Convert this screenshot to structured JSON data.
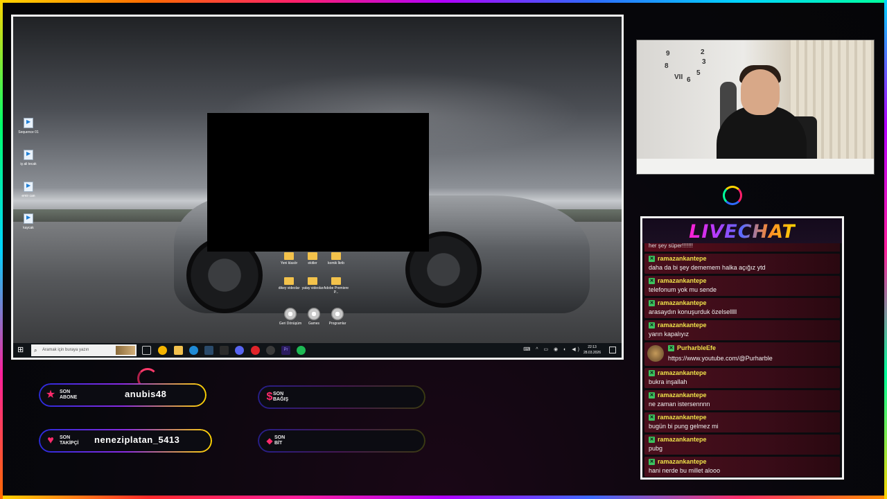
{
  "desktop": {
    "icons": [
      {
        "label": "Sequence 01"
      },
      {
        "label": "iş ali tecak"
      },
      {
        "label": "emir can"
      },
      {
        "label": "kaycak"
      }
    ],
    "folders": [
      {
        "label": "Yeni klasör"
      },
      {
        "label": "ekitler"
      },
      {
        "label": "komik İkrib"
      },
      {
        "label": "dikey videolar"
      },
      {
        "label": "yatay videolar"
      },
      {
        "label": "Adobe Premiere P..."
      }
    ],
    "bottom_icons": [
      {
        "label": "Geri Dönüşüm"
      },
      {
        "label": "Games"
      },
      {
        "label": "Programlar"
      }
    ]
  },
  "taskbar": {
    "search_placeholder": "Aramak için buraya yazın",
    "time": "22:13",
    "date": "28.03.2026",
    "apps": [
      "task-view",
      "chrome",
      "explorer",
      "edge",
      "steam",
      "app",
      "discord",
      "opera",
      "obs",
      "premiere",
      "spotify"
    ],
    "colors": {
      "chrome": "#f4b400",
      "explorer": "#f2c14e",
      "edge": "#1f8ad6",
      "steam": "#1b2838",
      "discord": "#5865f2",
      "opera": "#e0242a",
      "obs": "#3a3a3a",
      "premiere": "#2a1b5e",
      "spotify": "#1db954"
    }
  },
  "chat": {
    "title": "LIVECHAT",
    "cut_line": "her şey süper!!!!!!!",
    "messages": [
      {
        "user": "ramazankantepe",
        "text": "daha da bi şey dememem halka açığız ytd"
      },
      {
        "user": "ramazankantepe",
        "text": "telefonum yok mu sende"
      },
      {
        "user": "ramazankantepe",
        "text": "arasaydın konuşurduk özelselllll"
      },
      {
        "user": "ramazankantepe",
        "text": "yarın kapalıyız"
      },
      {
        "user": "PurharbleEfe",
        "text": "https://www.youtube.com/@Purharble"
      },
      {
        "user": "ramazankantepe",
        "text": "bukra inşallah"
      },
      {
        "user": "ramazankantepe",
        "text": "ne zaman istersennnn"
      },
      {
        "user": "ramazankantepe",
        "text": "bugün bi pung gelmez mi"
      },
      {
        "user": "ramazankantepe",
        "text": "pubg"
      },
      {
        "user": "ramazankantepe",
        "text": "hani nerde bu millet alooo"
      }
    ]
  },
  "alerts": {
    "abone": {
      "label_1": "SON",
      "label_2": "ABONE",
      "value": "anubis48",
      "icon": "star-icon",
      "color": "#ff2a6b"
    },
    "takipci": {
      "label_1": "SON",
      "label_2": "TAKİPÇİ",
      "value": "neneziplatan_5413",
      "icon": "heart-icon",
      "color": "#ff2a6b"
    },
    "bagis": {
      "label_1": "SON",
      "label_2": "BAĞIŞ",
      "value": "",
      "icon": "dollar-icon",
      "color": "#ff2a6b"
    },
    "bit": {
      "label_1": "SON",
      "label_2": "BİT",
      "value": "",
      "icon": "diamond-icon",
      "color": "#ff2a6b"
    }
  },
  "webcam": {
    "clock_numerals": [
      "9",
      "8",
      "VII",
      "6",
      "5",
      "3",
      "2"
    ]
  }
}
